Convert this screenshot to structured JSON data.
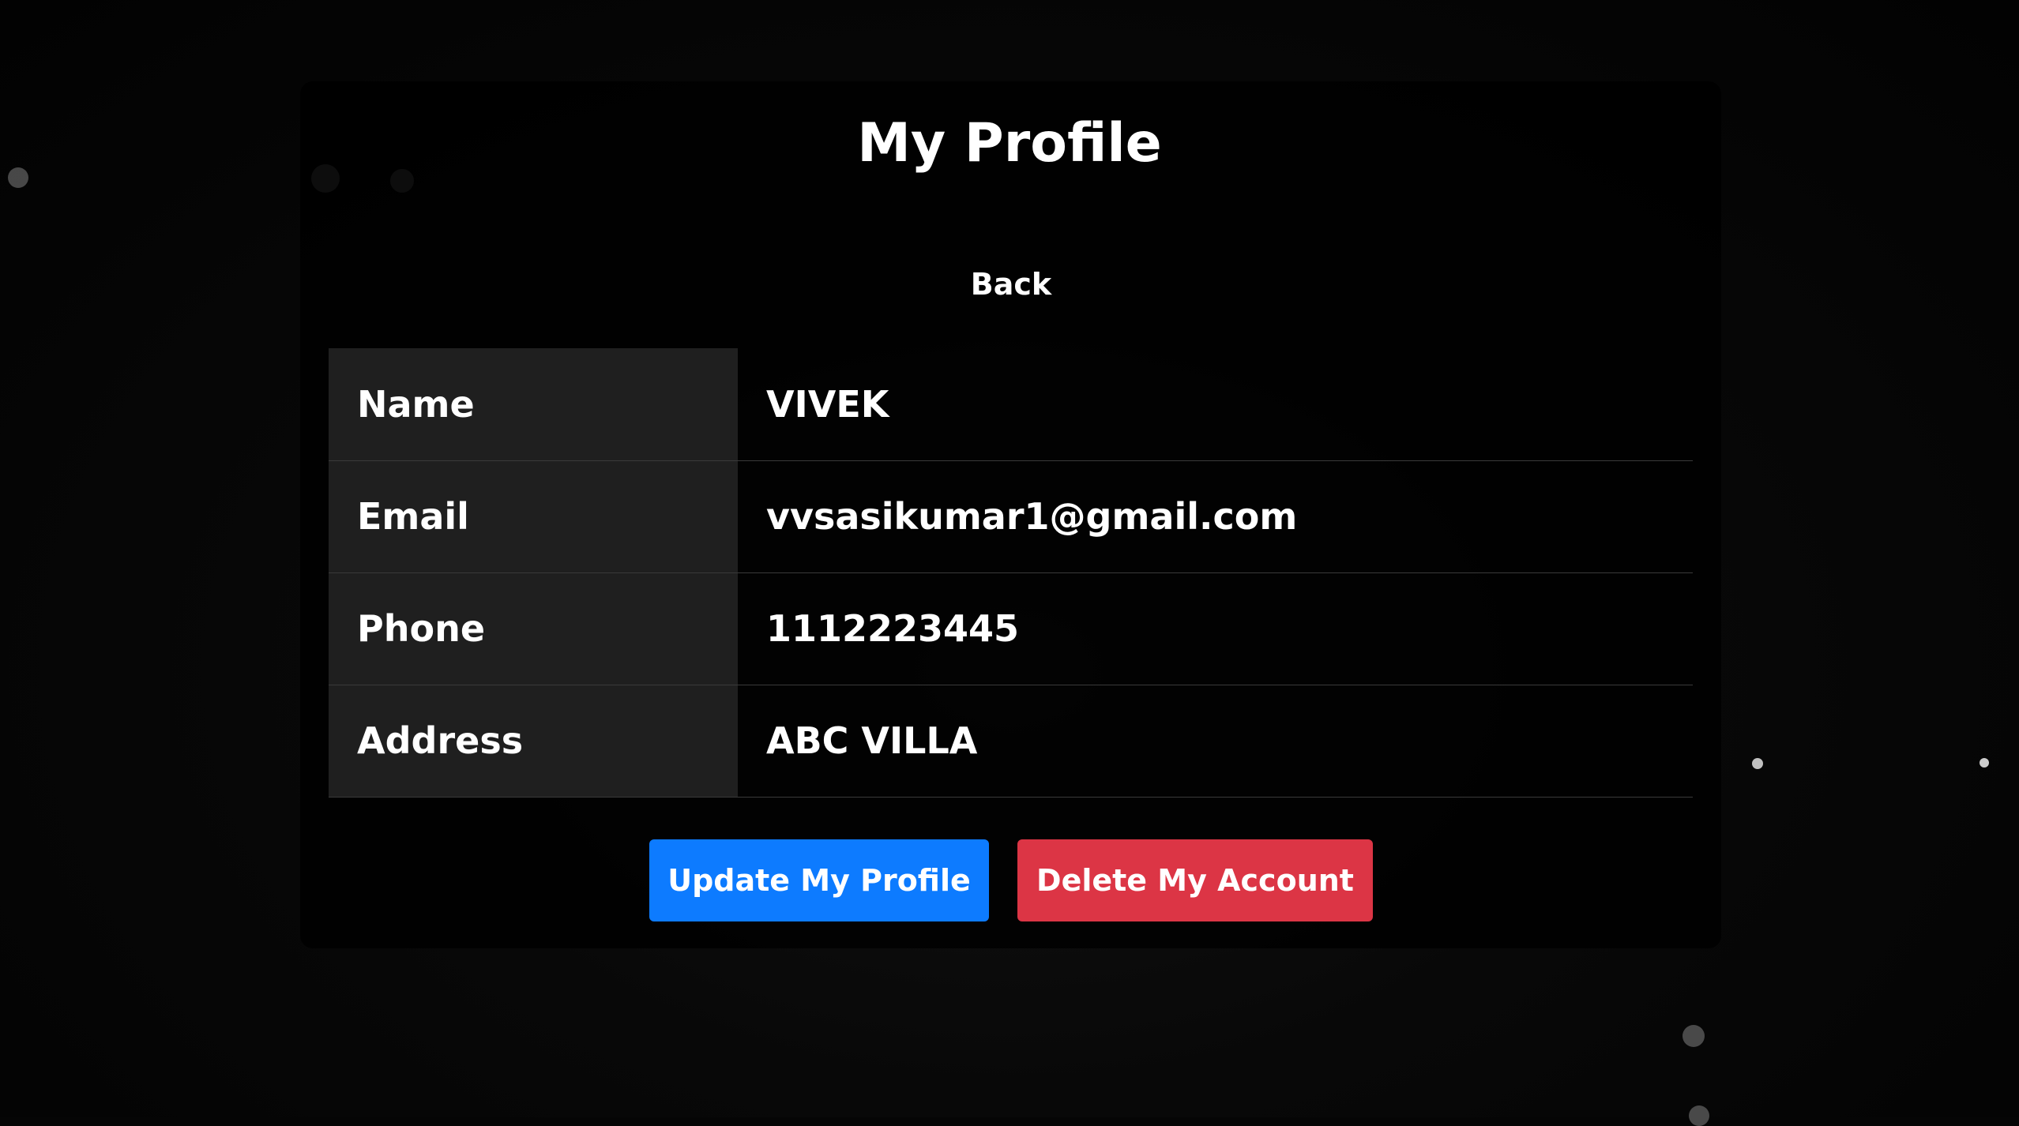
{
  "page": {
    "title": "My Profile",
    "back_label": "Back"
  },
  "profile": {
    "rows": [
      {
        "label": "Name",
        "value": "VIVEK"
      },
      {
        "label": "Email",
        "value": "vvsasikumar1@gmail.com"
      },
      {
        "label": "Phone",
        "value": "1112223445"
      },
      {
        "label": "Address",
        "value": "ABC VILLA"
      }
    ]
  },
  "actions": {
    "update_label": "Update My Profile",
    "delete_label": "Delete My Account"
  },
  "colors": {
    "update_button": "#0d7bff",
    "delete_button": "#dc3545",
    "background": "#050505"
  }
}
